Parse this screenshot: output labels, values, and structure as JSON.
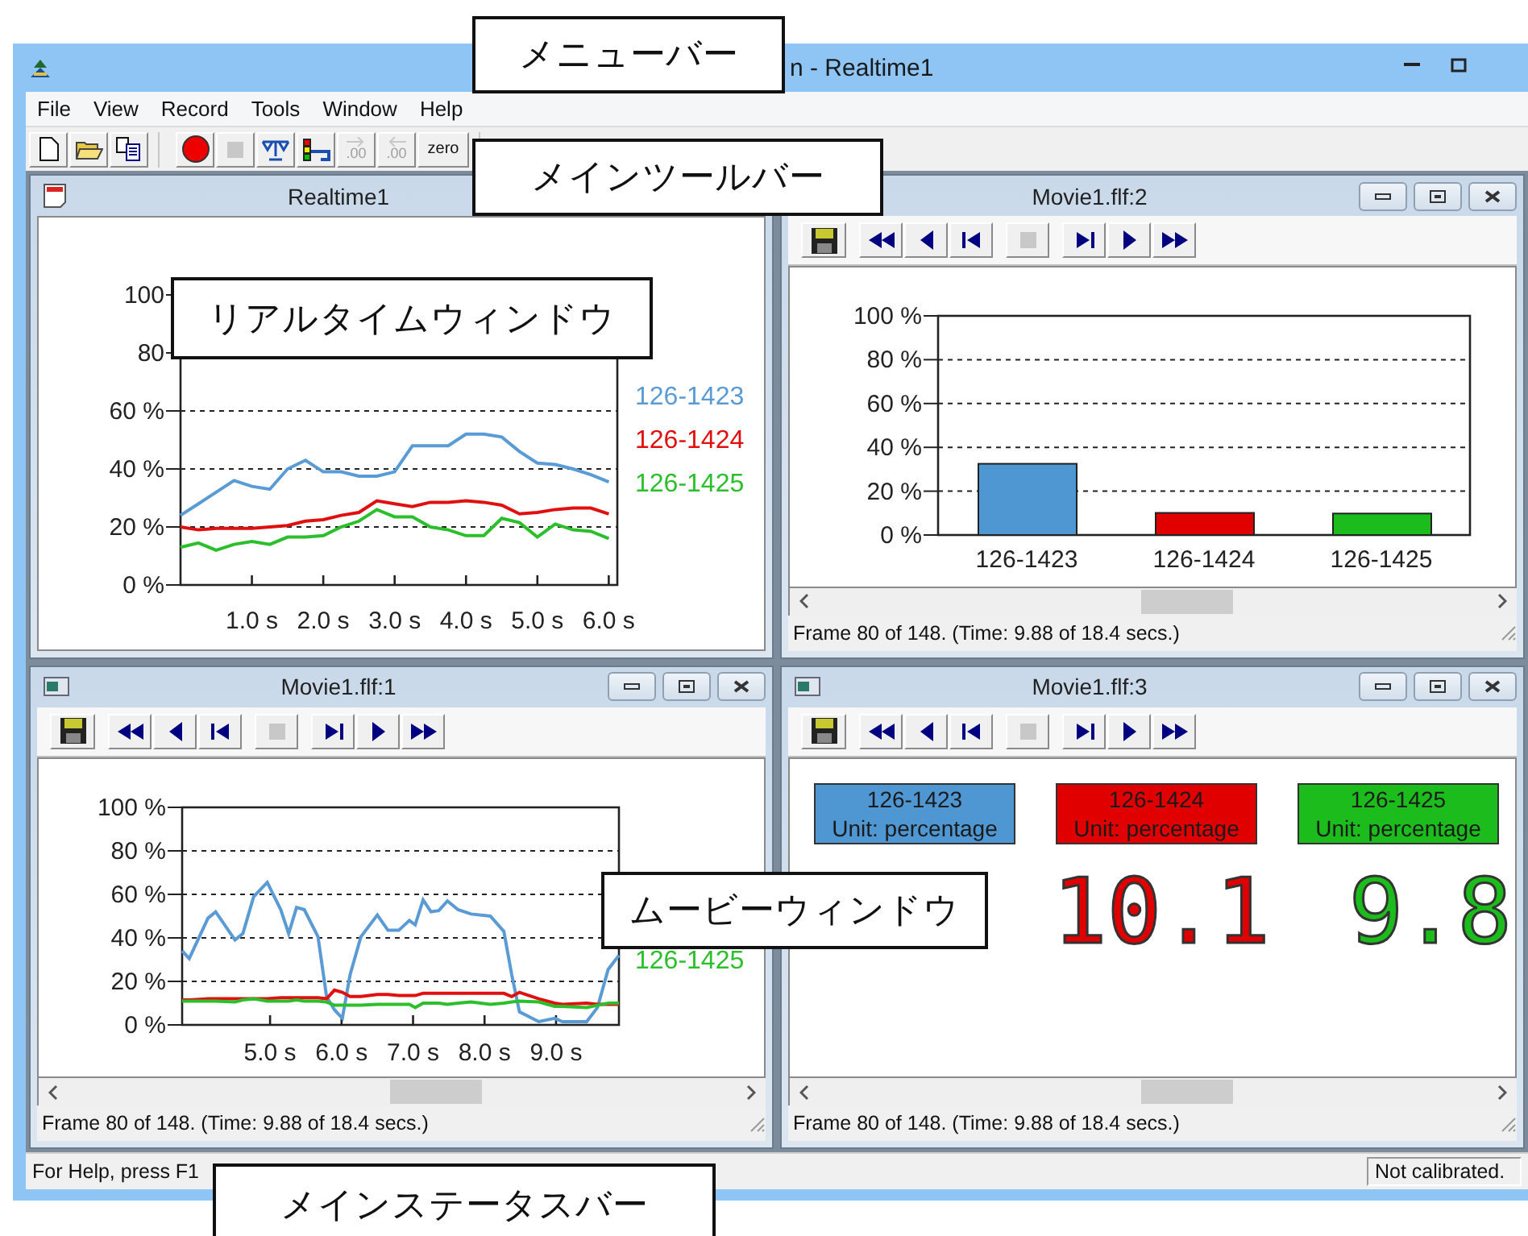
{
  "window": {
    "title": "n - Realtime1"
  },
  "menu": [
    {
      "label": "File"
    },
    {
      "label": "View"
    },
    {
      "label": "Record"
    },
    {
      "label": "Tools"
    },
    {
      "label": "Window"
    },
    {
      "label": "Help"
    }
  ],
  "toolbar": [
    [
      {
        "kind": "new",
        "disabled": false
      },
      {
        "kind": "open",
        "disabled": false
      },
      {
        "kind": "copy",
        "disabled": false
      }
    ],
    [
      {
        "kind": "record",
        "disabled": false
      },
      {
        "kind": "stop",
        "disabled": true
      },
      {
        "kind": "balance",
        "disabled": false
      },
      {
        "kind": "signal",
        "disabled": false
      },
      {
        "kind": "decimal_right",
        "label": ".00",
        "disabled": true
      },
      {
        "kind": "decimal_left",
        "label": ".00",
        "disabled": true
      },
      {
        "kind": "text",
        "label": "zero",
        "disabled": false
      }
    ]
  ],
  "children": [
    {
      "title": "Realtime1",
      "kind": "realtime",
      "chart_data": {
        "type": "line",
        "x": [
          0,
          0.25,
          0.5,
          0.75,
          1,
          1.25,
          1.5,
          1.75,
          2,
          2.25,
          2.5,
          2.75,
          3,
          3.25,
          3.5,
          3.75,
          4,
          4.25,
          4.5,
          4.75,
          5,
          5.25,
          5.5,
          5.75,
          6
        ],
        "series": [
          {
            "name": "126-1423",
            "color": "#5b9bd5",
            "values": [
              24,
              28,
              32,
              36,
              34,
              33,
              40,
              43,
              39,
              39,
              37.5,
              37.5,
              39,
              48,
              48,
              48,
              52,
              52,
              51,
              46,
              42,
              41.5,
              40,
              38,
              35.5
            ]
          },
          {
            "name": "126-1424",
            "color": "#e01010",
            "values": [
              20,
              19,
              19.5,
              19.5,
              19.5,
              20,
              20.5,
              22,
              22.5,
              24,
              25,
              29,
              28,
              27,
              28.5,
              28.5,
              29,
              28.5,
              27.5,
              24.5,
              25,
              26,
              26.5,
              26.5,
              24.5
            ]
          },
          {
            "name": "126-1425",
            "color": "#2cbf2c",
            "values": [
              13,
              14.5,
              12,
              14,
              15,
              14,
              16.5,
              16.5,
              17,
              20,
              22,
              26,
              23.5,
              23.5,
              20,
              19,
              17,
              17,
              23,
              21.5,
              16.5,
              21,
              19,
              18.5,
              16
            ]
          }
        ],
        "xlim": [
          0,
          6.12
        ],
        "ylim": [
          0,
          100
        ],
        "grid": true,
        "xticks": [
          {
            "value": 1,
            "label": "1.0 s"
          },
          {
            "value": 2,
            "label": "2.0 s"
          },
          {
            "value": 3,
            "label": "3.0 s"
          },
          {
            "value": 4,
            "label": "4.0 s"
          },
          {
            "value": 5,
            "label": "5.0 s"
          },
          {
            "value": 6,
            "label": "6.0 s"
          }
        ],
        "yticks": [
          {
            "value": 0,
            "label": "0 %"
          },
          {
            "value": 20,
            "label": "20 %"
          },
          {
            "value": 40,
            "label": "40 %"
          },
          {
            "value": 60,
            "label": "60 %"
          },
          {
            "value": 80,
            "label": "80"
          },
          {
            "value": 100,
            "label": "100"
          }
        ]
      }
    },
    {
      "title": "Movie1.flf:2",
      "kind": "bar",
      "toolbar": [
        [
          {
            "kind": "save",
            "disabled": false
          }
        ],
        [
          {
            "kind": "rewind",
            "disabled": false
          },
          {
            "kind": "step_back",
            "disabled": false
          },
          {
            "kind": "to_start",
            "disabled": false
          }
        ],
        [
          {
            "kind": "stop",
            "disabled": true
          }
        ],
        [
          {
            "kind": "to_end",
            "disabled": false
          },
          {
            "kind": "play",
            "disabled": false
          },
          {
            "kind": "fast_forward",
            "disabled": false
          }
        ]
      ],
      "chart_data": {
        "type": "bar",
        "categories": [
          "126-1423",
          "126-1424",
          "126-1425"
        ],
        "series": [
          {
            "color": "#4f97d3",
            "values": [
              32.5,
              null,
              null
            ]
          },
          {
            "color": "#e00000",
            "values": [
              null,
              10.1,
              null
            ]
          },
          {
            "color": "#1cbc1c",
            "values": [
              null,
              null,
              9.8
            ]
          }
        ],
        "ylim": [
          0,
          100
        ],
        "grid": true,
        "yticks": [
          {
            "value": 0,
            "label": "0 %"
          },
          {
            "value": 20,
            "label": "20 %"
          },
          {
            "value": 40,
            "label": "40 %"
          },
          {
            "value": 60,
            "label": "60 %"
          },
          {
            "value": 80,
            "label": "80 %"
          },
          {
            "value": 100,
            "label": "100 %"
          }
        ]
      },
      "status": "Frame 80 of 148. (Time: 9.88 of 18.4 secs.)"
    },
    {
      "title": "Movie1.flf:1",
      "kind": "line",
      "toolbar": [
        [
          {
            "kind": "save",
            "disabled": false
          }
        ],
        [
          {
            "kind": "rewind",
            "disabled": false
          },
          {
            "kind": "step_back",
            "disabled": false
          },
          {
            "kind": "to_start",
            "disabled": false
          }
        ],
        [
          {
            "kind": "stop",
            "disabled": true
          }
        ],
        [
          {
            "kind": "to_end",
            "disabled": false
          },
          {
            "kind": "play",
            "disabled": false
          },
          {
            "kind": "fast_forward",
            "disabled": false
          }
        ]
      ],
      "chart_data": {
        "type": "line",
        "x": [
          3.77,
          3.87,
          4.13,
          4.24,
          4.51,
          4.62,
          4.77,
          4.96,
          5.15,
          5.26,
          5.37,
          5.48,
          5.67,
          5.79,
          5.9,
          6.01,
          6.12,
          6.27,
          6.5,
          6.65,
          6.8,
          6.95,
          7.03,
          7.14,
          7.25,
          7.36,
          7.48,
          7.63,
          7.81,
          8.08,
          8.27,
          8.38,
          8.49,
          8.76,
          8.98,
          9.09,
          9.43,
          9.58,
          9.73,
          9.88
        ],
        "series": [
          {
            "color": "#5b9bd5",
            "values": [
              34,
              30.5,
              49,
              52,
              39,
              42,
              59,
              65.5,
              53,
              42,
              54,
              53,
              40.5,
              13,
              7,
              3,
              23,
              40.5,
              50.5,
              43.5,
              43.5,
              48,
              46,
              57.5,
              52,
              52.5,
              57,
              53,
              51,
              50,
              43,
              23,
              6,
              1.5,
              3,
              1.5,
              1.5,
              8,
              25.5,
              32
            ]
          },
          {
            "color": "#e01010",
            "values": [
              11.5,
              11.5,
              12,
              12,
              12,
              12,
              12,
              12,
              12.5,
              12.5,
              12.5,
              12.5,
              12.5,
              12,
              16,
              15,
              13,
              13,
              14,
              14,
              13.5,
              13.5,
              13.5,
              14.5,
              14.5,
              14.5,
              14.5,
              14.5,
              14.5,
              14.5,
              14.5,
              13,
              15,
              12,
              10,
              9.5,
              10,
              9.5,
              9.5,
              9.5
            ]
          },
          {
            "name": "126-1425",
            "color": "#2cbf2c",
            "values": [
              11,
              11,
              11,
              11,
              10.5,
              11.5,
              12,
              11,
              11,
              11,
              11.5,
              11,
              11,
              10.5,
              9,
              9,
              9,
              9,
              9.5,
              9.5,
              9.5,
              9.5,
              8,
              10,
              10,
              10,
              9.5,
              10,
              10.5,
              9.5,
              10,
              10.5,
              11,
              10.5,
              8.5,
              8.5,
              8,
              9,
              10,
              10
            ]
          }
        ],
        "xlim": [
          3.77,
          9.88
        ],
        "ylim": [
          0,
          100
        ],
        "grid": true,
        "xticks": [
          {
            "value": 5,
            "label": "5.0 s"
          },
          {
            "value": 6,
            "label": "6.0 s"
          },
          {
            "value": 7,
            "label": "7.0 s"
          },
          {
            "value": 8,
            "label": "8.0 s"
          },
          {
            "value": 9,
            "label": "9.0 s"
          }
        ],
        "yticks": [
          {
            "value": 0,
            "label": "0 %"
          },
          {
            "value": 20,
            "label": "20 %"
          },
          {
            "value": 40,
            "label": "40 %"
          },
          {
            "value": 60,
            "label": "60 %"
          },
          {
            "value": 80,
            "label": "80 %"
          },
          {
            "value": 100,
            "label": "100 %"
          }
        ]
      },
      "status": "Frame 80 of 148. (Time: 9.88 of 18.4 secs.)"
    },
    {
      "title": "Movie1.flf:3",
      "kind": "displays",
      "toolbar": [
        [
          {
            "kind": "save",
            "disabled": false
          }
        ],
        [
          {
            "kind": "rewind",
            "disabled": false
          },
          {
            "kind": "step_back",
            "disabled": false
          },
          {
            "kind": "to_start",
            "disabled": false
          }
        ],
        [
          {
            "kind": "stop",
            "disabled": true
          }
        ],
        [
          {
            "kind": "to_end",
            "disabled": false
          },
          {
            "kind": "play",
            "disabled": false
          },
          {
            "kind": "fast_forward",
            "disabled": false
          }
        ]
      ],
      "displays": [
        {
          "name": "126-1423",
          "unit": "Unit: percentage",
          "color": "#4f97d3"
        },
        {
          "name": "126-1424",
          "unit": "Unit: percentage",
          "color": "#e00000",
          "reading": "10.1"
        },
        {
          "name": "126-1425",
          "unit": "Unit: percentage",
          "color": "#1cbc1c",
          "reading": "9.8"
        }
      ],
      "status": "Frame 80 of 148. (Time: 9.88 of 18.4 secs.)"
    }
  ],
  "status_bar": {
    "help": "For Help, press F1",
    "calibration": "Not calibrated."
  },
  "callouts": [
    {
      "kind": "menu_bar",
      "text": "メニューバー"
    },
    {
      "kind": "main_toolbar",
      "text": "メインツールバー"
    },
    {
      "kind": "realtime_window",
      "text": "リアルタイムウィンドウ"
    },
    {
      "kind": "movie_window",
      "text": "ムービーウィンドウ"
    },
    {
      "kind": "main_status_bar",
      "text": "メインステータスバー"
    }
  ]
}
